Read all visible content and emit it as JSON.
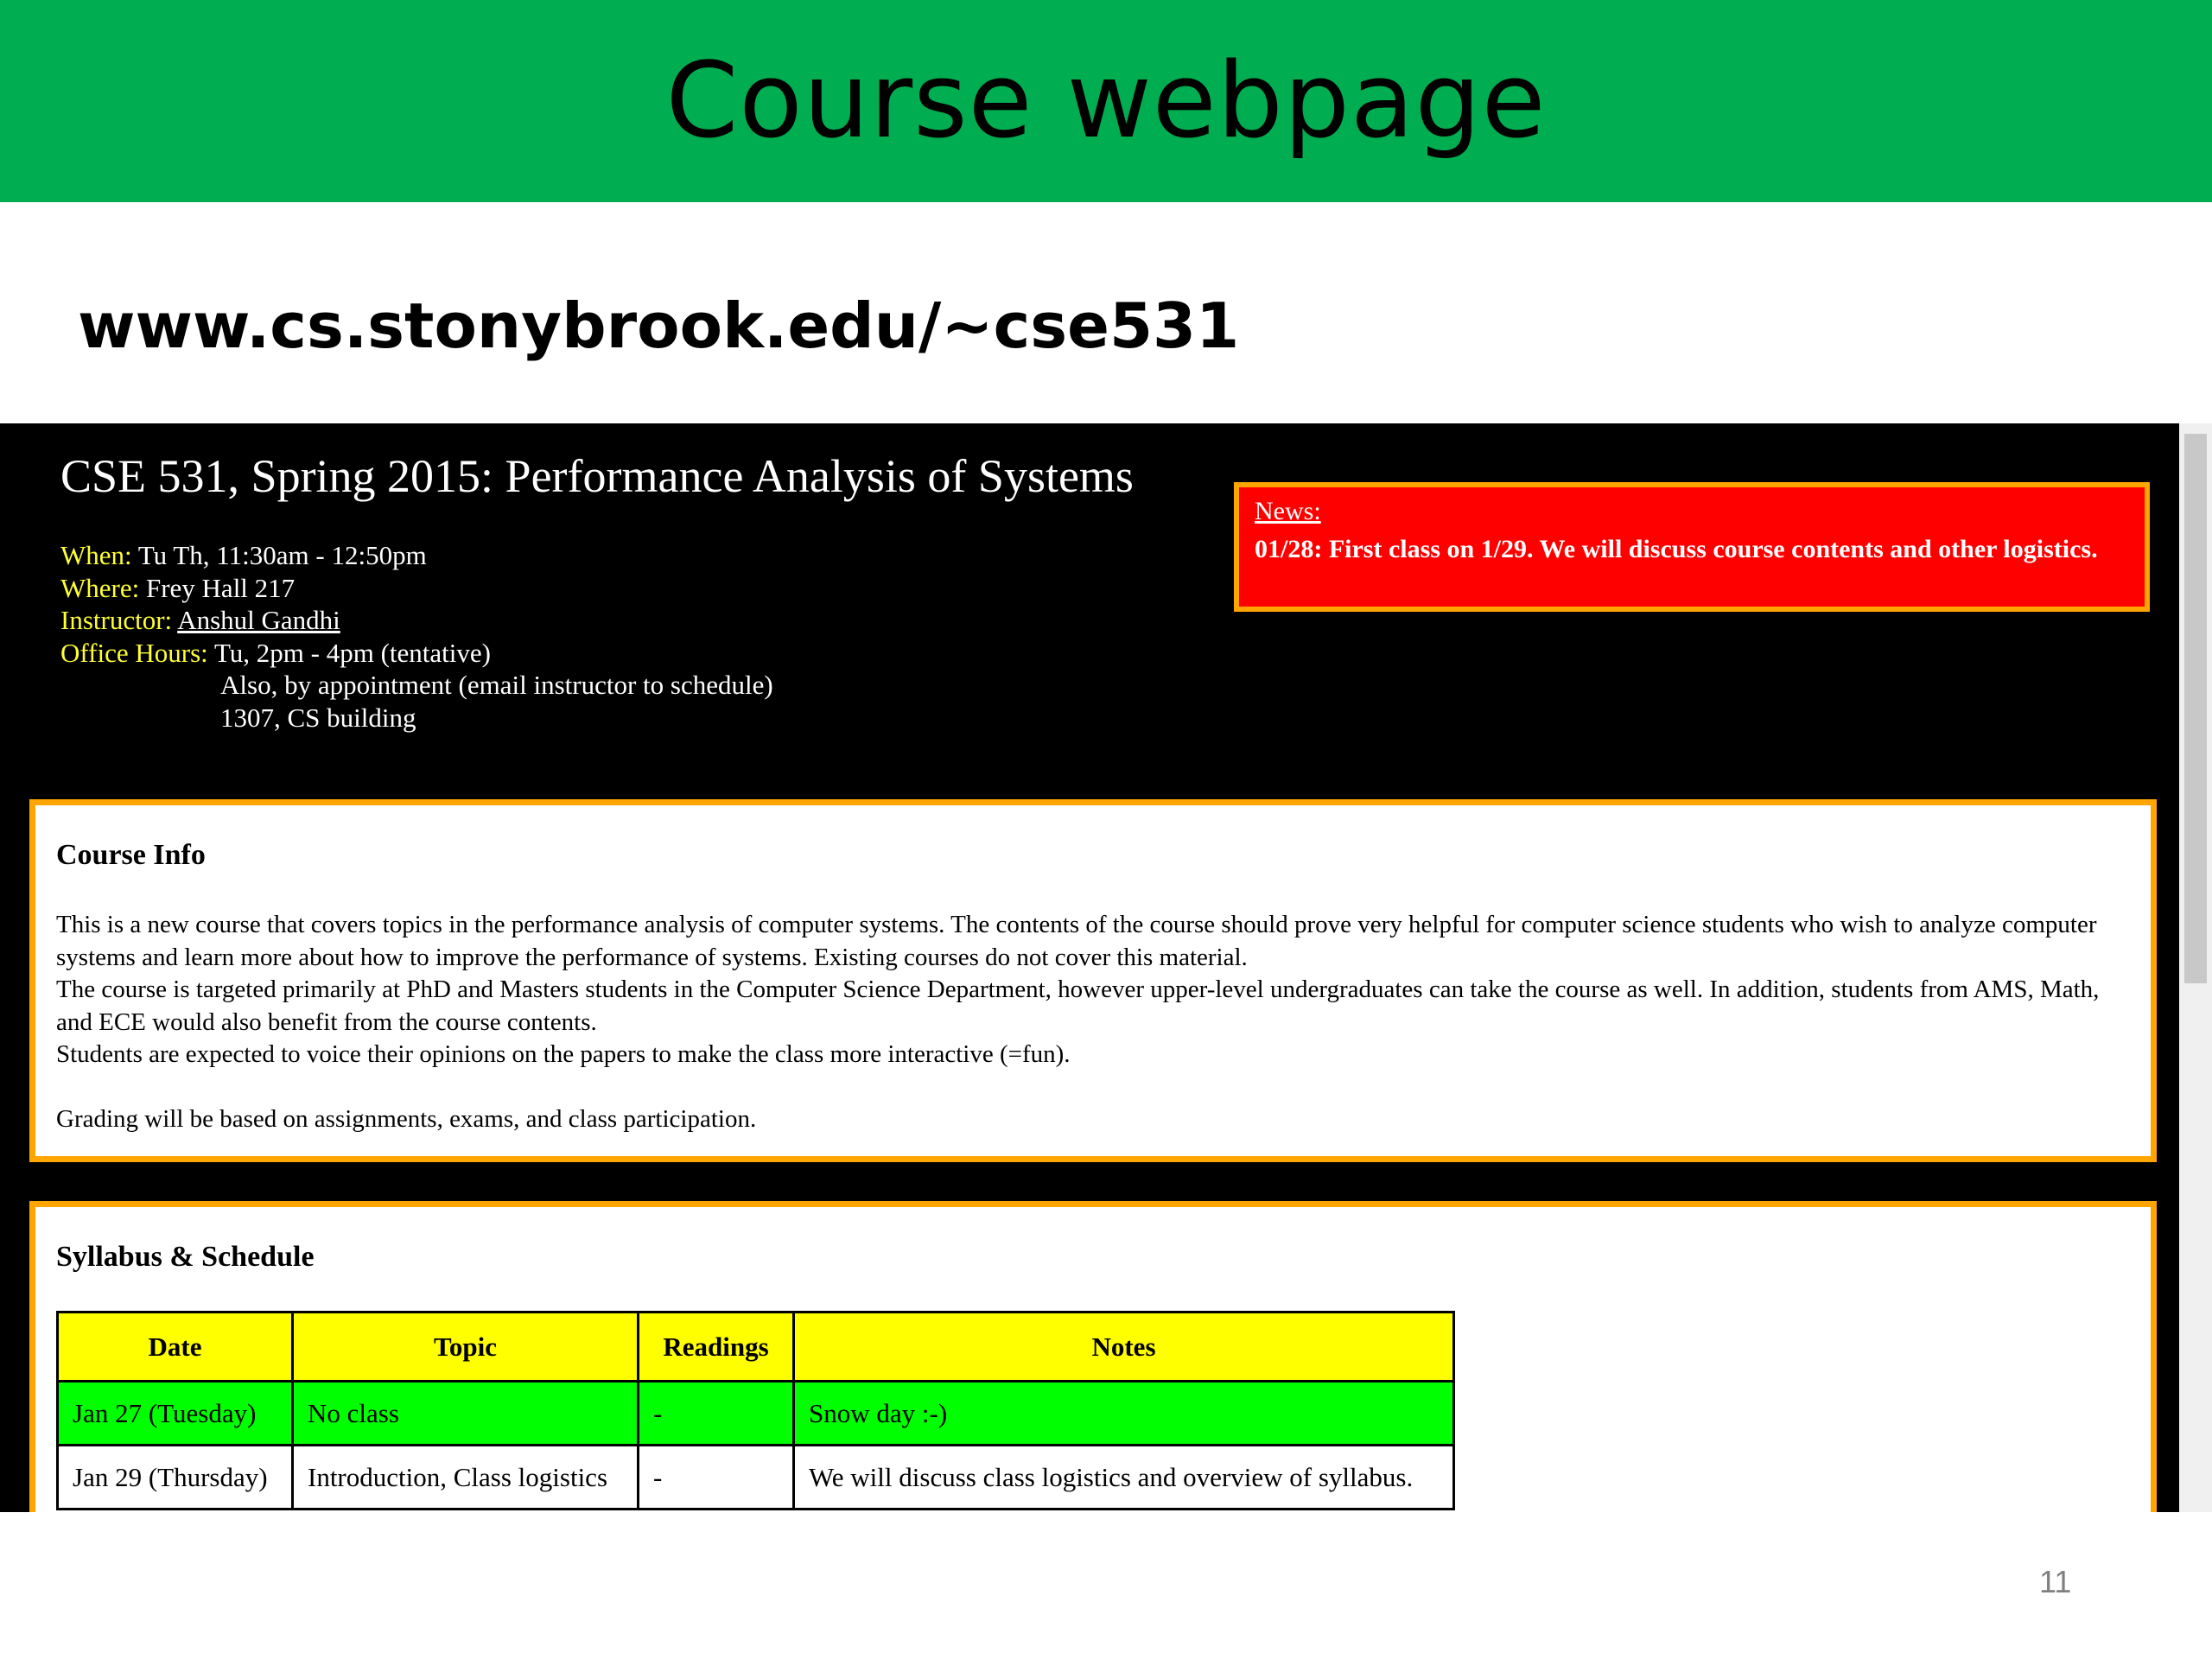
{
  "slide": {
    "title": "Course webpage",
    "url": "www.cs.stonybrook.edu/~cse531",
    "page_number": "11"
  },
  "webpage": {
    "course_title": "CSE 531, Spring 2015: Performance Analysis of Systems",
    "info": {
      "when_label": "When:",
      "when_value": " Tu Th, 11:30am - 12:50pm",
      "where_label": "Where:",
      "where_value": " Frey Hall 217",
      "instructor_label": "Instructor:",
      "instructor_name": "Anshul Gandhi",
      "office_hours_label": "Office Hours:",
      "office_hours_value": " Tu, 2pm - 4pm (tentative)",
      "office_hours_line2": "Also, by appointment (email instructor to schedule)",
      "office_hours_line3": "1307, CS building"
    },
    "news": {
      "heading": "News:",
      "text": "01/28: First class on 1/29. We will discuss course contents and other logistics."
    },
    "course_info": {
      "heading": "Course Info",
      "paragraph1": "This is a new course that covers topics in the performance analysis of computer systems. The contents of the course should prove very helpful for computer science students who wish to analyze computer systems and learn more about how to improve the performance of systems. Existing courses do not cover this material.",
      "paragraph2": "The course is targeted primarily at PhD and Masters students in the Computer Science Department, however upper-level undergraduates can take the course as well. In addition, students from AMS, Math, and ECE would also benefit from the course contents.",
      "paragraph3": "Students are expected to voice their opinions on the papers to make the class more interactive (=fun).",
      "paragraph4": "Grading will be based on assignments, exams, and class participation."
    },
    "syllabus": {
      "heading": "Syllabus & Schedule",
      "columns": [
        "Date",
        "Topic",
        "Readings",
        "Notes"
      ],
      "rows": [
        {
          "date": "Jan 27 (Tuesday)",
          "topic": "No class",
          "readings": "-",
          "notes": "Snow day :-)"
        },
        {
          "date": "Jan 29 (Thursday)",
          "topic": "Introduction, Class logistics",
          "readings": "-",
          "notes": "We will discuss class logistics and overview of syllabus."
        }
      ]
    }
  }
}
